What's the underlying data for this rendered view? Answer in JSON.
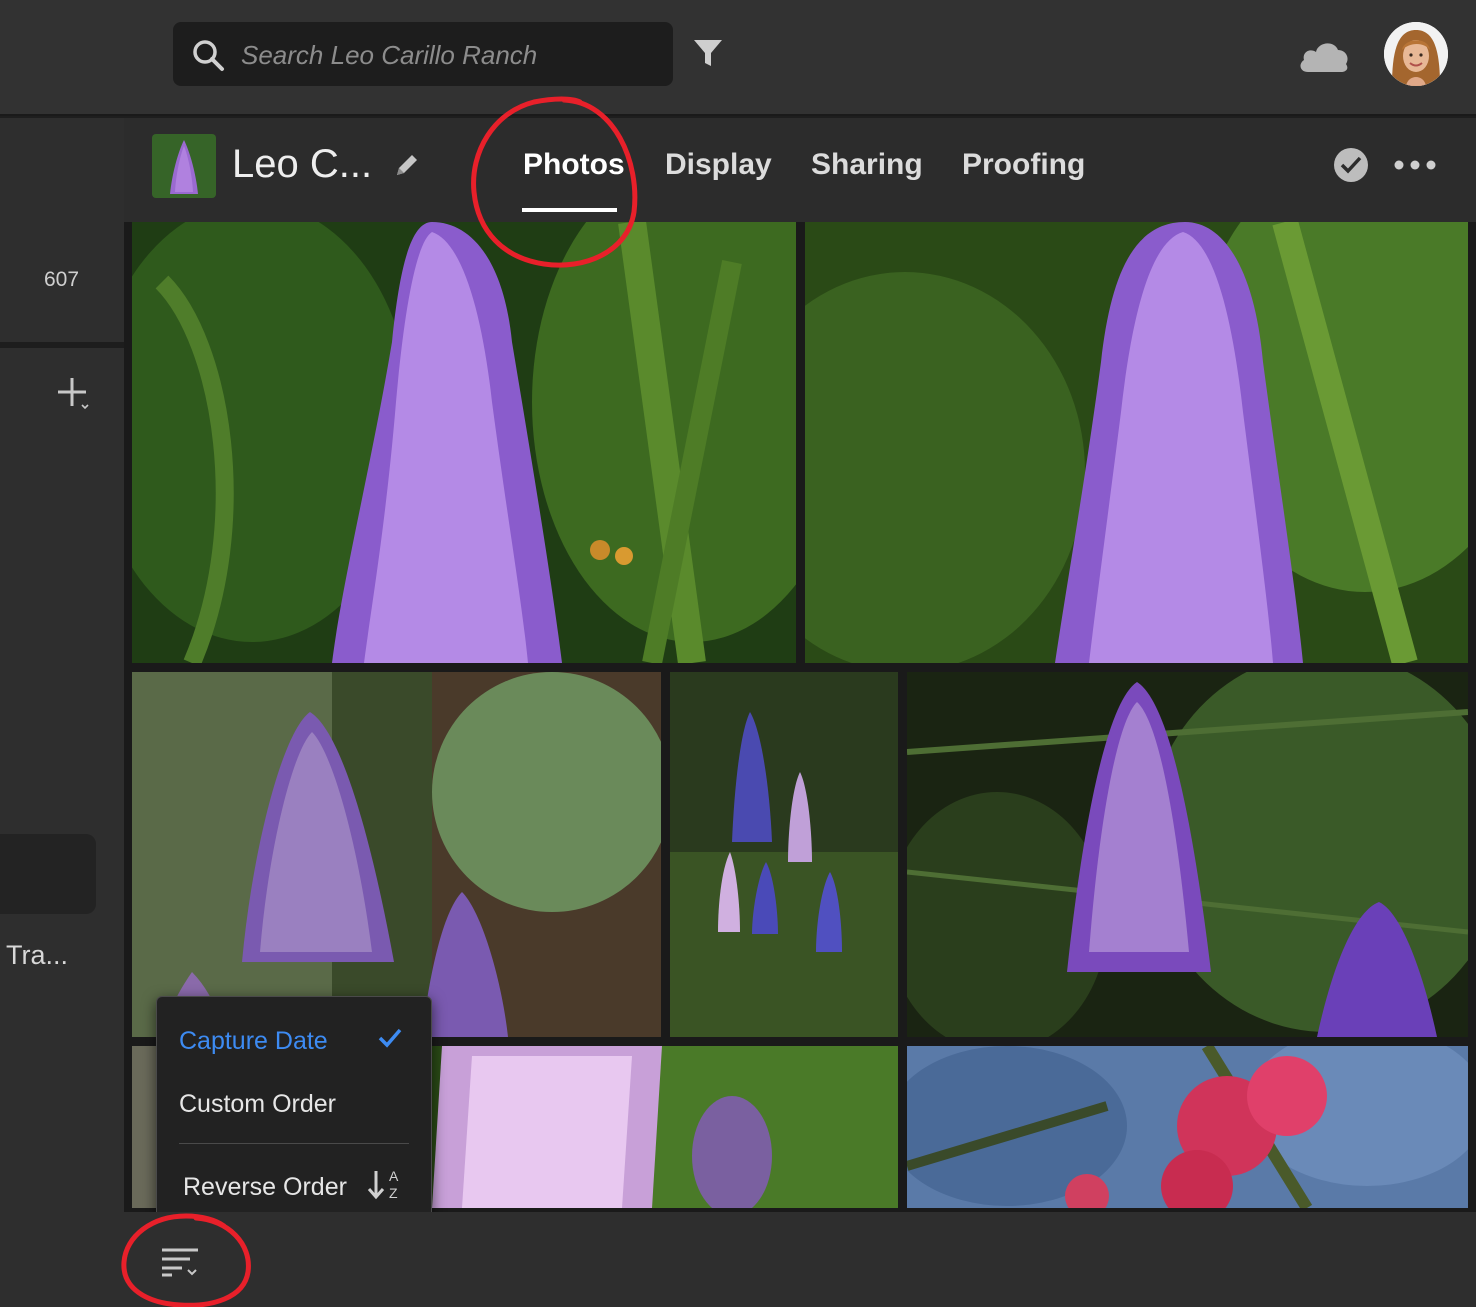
{
  "search": {
    "placeholder": "Search Leo Carillo Ranch"
  },
  "rail": {
    "count": "607",
    "truncated_label": "Tra..."
  },
  "album": {
    "name": "Leo C..."
  },
  "tabs": [
    {
      "label": "Photos",
      "active": true
    },
    {
      "label": "Display"
    },
    {
      "label": "Sharing"
    },
    {
      "label": "Proofing"
    }
  ],
  "sort_menu": {
    "items": [
      {
        "label": "Capture Date",
        "selected": true
      },
      {
        "label": "Custom Order"
      },
      {
        "label": "Reverse Order"
      }
    ],
    "reverse_icon_letters": [
      "A",
      "Z"
    ]
  },
  "icons": [
    "search-icon",
    "filter-icon",
    "cloud-icon",
    "avatar",
    "pencil-icon",
    "checkmark-circle-icon",
    "more-icon",
    "plus-icon",
    "sort-icon",
    "checkmark-icon",
    "sort-az-icon"
  ],
  "colors": {
    "accent": "#3d8bf2",
    "annotation": "#e8202a"
  }
}
